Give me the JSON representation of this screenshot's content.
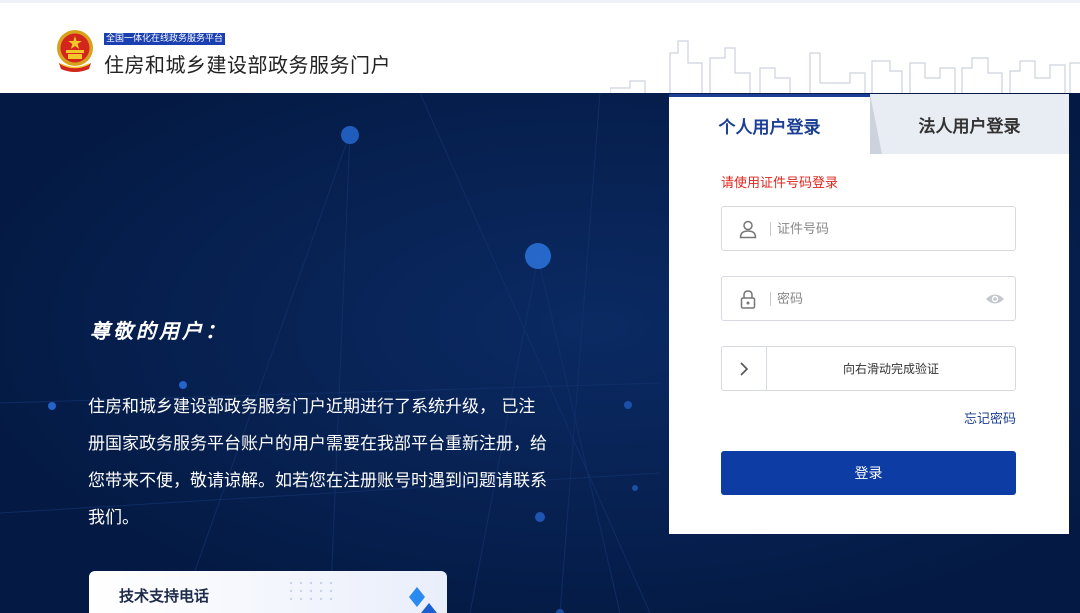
{
  "header": {
    "platform_tag": "全国一体化在线政务服务平台",
    "portal_title": "住房和城乡建设部政务服务门户"
  },
  "hero": {
    "greeting": "尊敬的用户：",
    "notice": "住房和城乡建设部政务服务门户近期进行了系统升级， 已注册国家政务服务平台账户的用户需要在我部平台重新注册，给您带来不便，敬请谅解。如若您在注册账号时遇到问题请联系我们。",
    "support_title": "技术支持电话"
  },
  "login": {
    "tabs": [
      {
        "label": "个人用户登录",
        "active": true
      },
      {
        "label": "法人用户登录",
        "active": false
      }
    ],
    "hint": "请使用证件号码登录",
    "id_field": {
      "placeholder": "证件号码",
      "value": ""
    },
    "password_field": {
      "placeholder": "密码",
      "value": ""
    },
    "slider_text": "向右滑动完成验证",
    "forgot_label": "忘记密码",
    "submit_label": "登录"
  },
  "colors": {
    "primary": "#0d3ca5",
    "hero_background": "#041a44",
    "hint": "#e0251b",
    "platform_tag_bg": "#1a3fb0"
  },
  "icons": [
    "national-emblem-icon",
    "user-icon",
    "lock-icon",
    "eye-icon",
    "chevron-right-icon",
    "diamond-icon"
  ]
}
